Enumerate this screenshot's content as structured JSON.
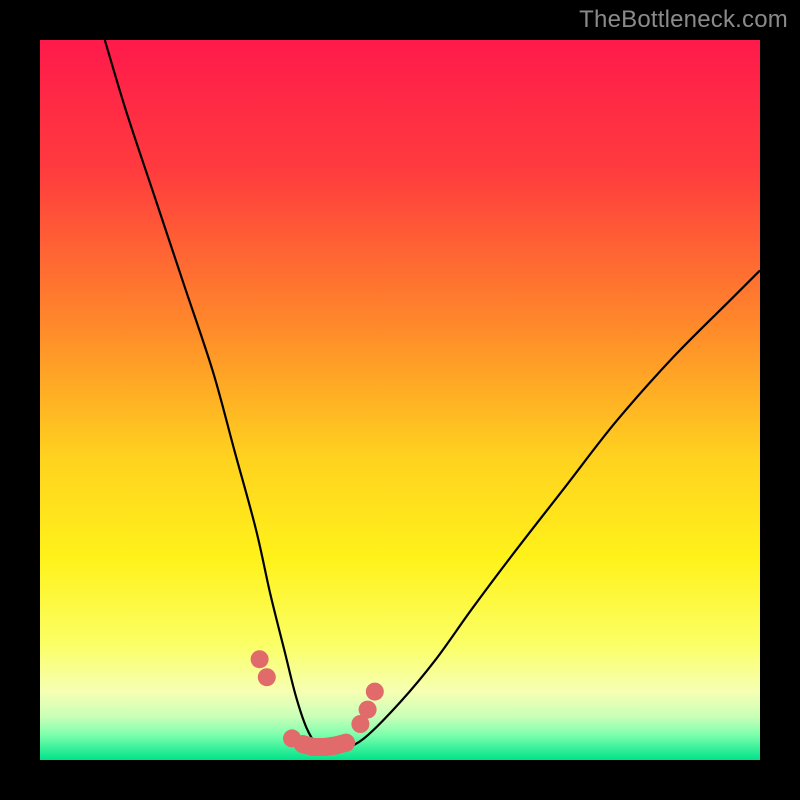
{
  "watermark": "TheBottleneck.com",
  "chart_data": {
    "type": "line",
    "title": "",
    "xlabel": "",
    "ylabel": "",
    "xlim": [
      0,
      100
    ],
    "ylim": [
      0,
      100
    ],
    "gradient_stops": [
      {
        "offset": 0,
        "color": "#ff1a4b"
      },
      {
        "offset": 0.18,
        "color": "#ff3b3e"
      },
      {
        "offset": 0.4,
        "color": "#ff8a2a"
      },
      {
        "offset": 0.58,
        "color": "#ffd21f"
      },
      {
        "offset": 0.72,
        "color": "#fff21a"
      },
      {
        "offset": 0.84,
        "color": "#fbff66"
      },
      {
        "offset": 0.905,
        "color": "#f6ffb3"
      },
      {
        "offset": 0.94,
        "color": "#c9ffb8"
      },
      {
        "offset": 0.965,
        "color": "#7dffad"
      },
      {
        "offset": 1.0,
        "color": "#00e38a"
      }
    ],
    "series": [
      {
        "name": "bottleneck-curve",
        "x": [
          9,
          12,
          16,
          20,
          24,
          27,
          30,
          32,
          34,
          35.5,
          37,
          38.5,
          40,
          42,
          45,
          50,
          55,
          60,
          66,
          73,
          80,
          88,
          96,
          100
        ],
        "y": [
          100,
          90,
          78,
          66,
          54,
          43,
          32,
          23,
          15,
          9,
          4.5,
          2,
          1,
          1.5,
          3,
          8,
          14,
          21,
          29,
          38,
          47,
          56,
          64,
          68
        ]
      },
      {
        "name": "threshold-markers",
        "x": [
          30.5,
          31.5,
          35,
          36.5,
          38,
          39.5,
          41,
          42.5,
          44.5,
          45.5,
          46.5
        ],
        "y": [
          14,
          11.5,
          3,
          2.2,
          1.8,
          1.8,
          2,
          2.4,
          5,
          7,
          9.5
        ]
      }
    ],
    "marker_color": "#e16a6a",
    "curve_color": "#000000"
  }
}
